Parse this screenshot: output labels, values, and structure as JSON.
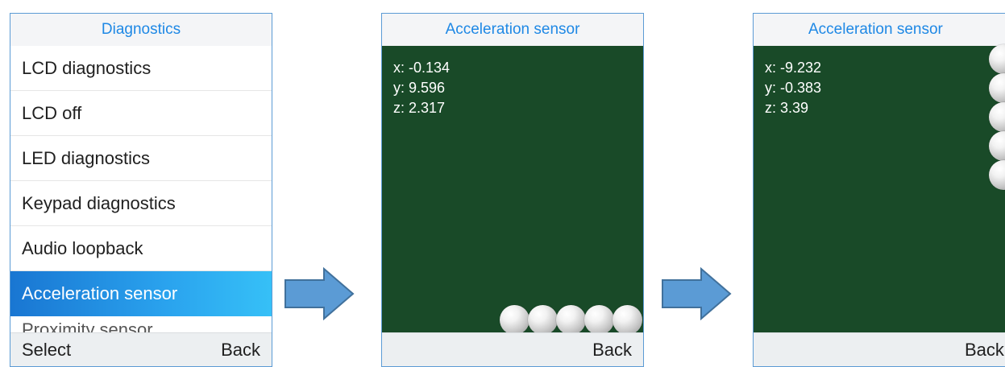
{
  "screens": {
    "menu": {
      "title": "Diagnostics",
      "items": [
        {
          "label": "LCD diagnostics"
        },
        {
          "label": "LCD off"
        },
        {
          "label": "LED diagnostics"
        },
        {
          "label": "Keypad diagnostics"
        },
        {
          "label": "Audio loopback"
        },
        {
          "label": "Acceleration sensor",
          "selected": true
        },
        {
          "label": "Proximity sensor",
          "partial": true
        }
      ],
      "softkeys": {
        "left": "Select",
        "right": "Back"
      }
    },
    "sensor_upright": {
      "title": "Acceleration sensor",
      "readouts": {
        "x": "x: -0.134",
        "y": "y: 9.596",
        "z": "z: 2.317"
      },
      "ball_count": 5,
      "ball_arrangement": "bottom-row",
      "softkeys": {
        "right": "Back"
      }
    },
    "sensor_tilted": {
      "title": "Acceleration sensor",
      "readouts": {
        "x": "x: -9.232",
        "y": "y: -0.383",
        "z": "z: 3.39"
      },
      "ball_count": 5,
      "ball_arrangement": "right-column",
      "softkeys": {
        "right": "Back"
      }
    }
  },
  "icons": {
    "arrow": "right-arrow-icon",
    "ball": "steel-ball-icon"
  },
  "colors": {
    "title_text": "#1e88e5",
    "sensor_background": "#194a28",
    "selection_start": "#1976d2",
    "selection_end": "#36c0f7",
    "arrow_fill": "#5b9bd5",
    "arrow_outline": "#41719c",
    "frame_border": "#5b9bd5"
  }
}
